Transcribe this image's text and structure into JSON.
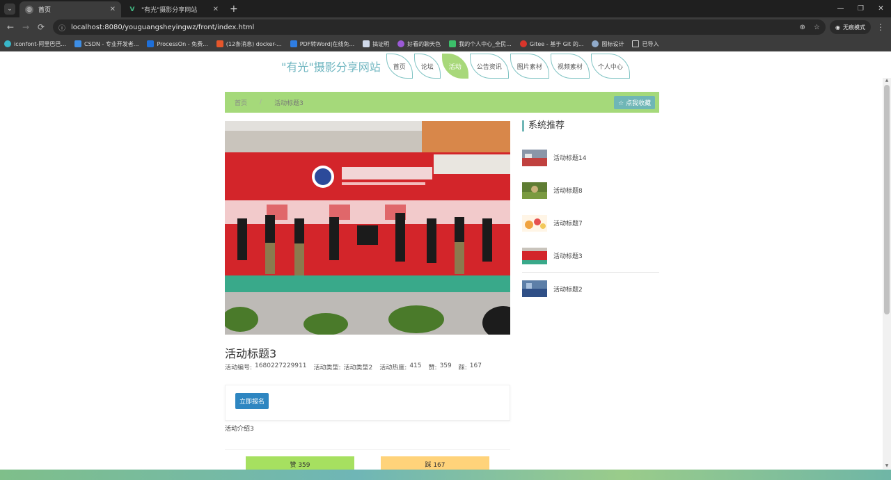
{
  "browser": {
    "tabs": [
      {
        "title": "首页",
        "active": true
      },
      {
        "title": "\"有光\"摄影分享网站",
        "active": false
      }
    ],
    "url": "localhost:8080/youguangsheyingwz/front/index.html",
    "incognito_label": "无痕模式",
    "bookmarks": [
      "iconfont-阿里巴巴...",
      "CSDN - 专业开发者...",
      "ProcessOn - 免费...",
      "(12条消息) docker-...",
      "PDF转Word|在线免...",
      "搞证明",
      "好看的聊天色",
      "我的个人中心_全民...",
      "Gitee - 基于 Git 的...",
      "图标设计",
      "已导入"
    ]
  },
  "site": {
    "logo": "\"有光\"摄影分享网站",
    "nav": [
      "首页",
      "论坛",
      "活动",
      "公告资讯",
      "图片素材",
      "视频素材",
      "个人中心"
    ],
    "nav_active_index": 2
  },
  "breadcrumb": {
    "home": "首页",
    "sep": "/",
    "current": "活动标题3",
    "favorite_btn": "☆ 点我收藏"
  },
  "detail": {
    "title": "活动标题3",
    "meta": {
      "id_label": "活动编号:",
      "id_value": "1680227229911",
      "type_label": "活动类型:",
      "type_value": "活动类型2",
      "heat_label": "活动热度:",
      "heat_value": "415",
      "like_label": "赞:",
      "like_value": "359",
      "dislike_label": "踩:",
      "dislike_value": "167"
    },
    "signup_btn": "立即报名",
    "intro": "活动介绍3",
    "vote_like": "赞 359",
    "vote_dislike": "踩 167"
  },
  "recommend": {
    "title": "系统推荐",
    "items": [
      {
        "label": "活动标题14"
      },
      {
        "label": "活动标题8"
      },
      {
        "label": "活动标题7"
      },
      {
        "label": "活动标题3"
      },
      {
        "label": "活动标题2"
      }
    ]
  }
}
